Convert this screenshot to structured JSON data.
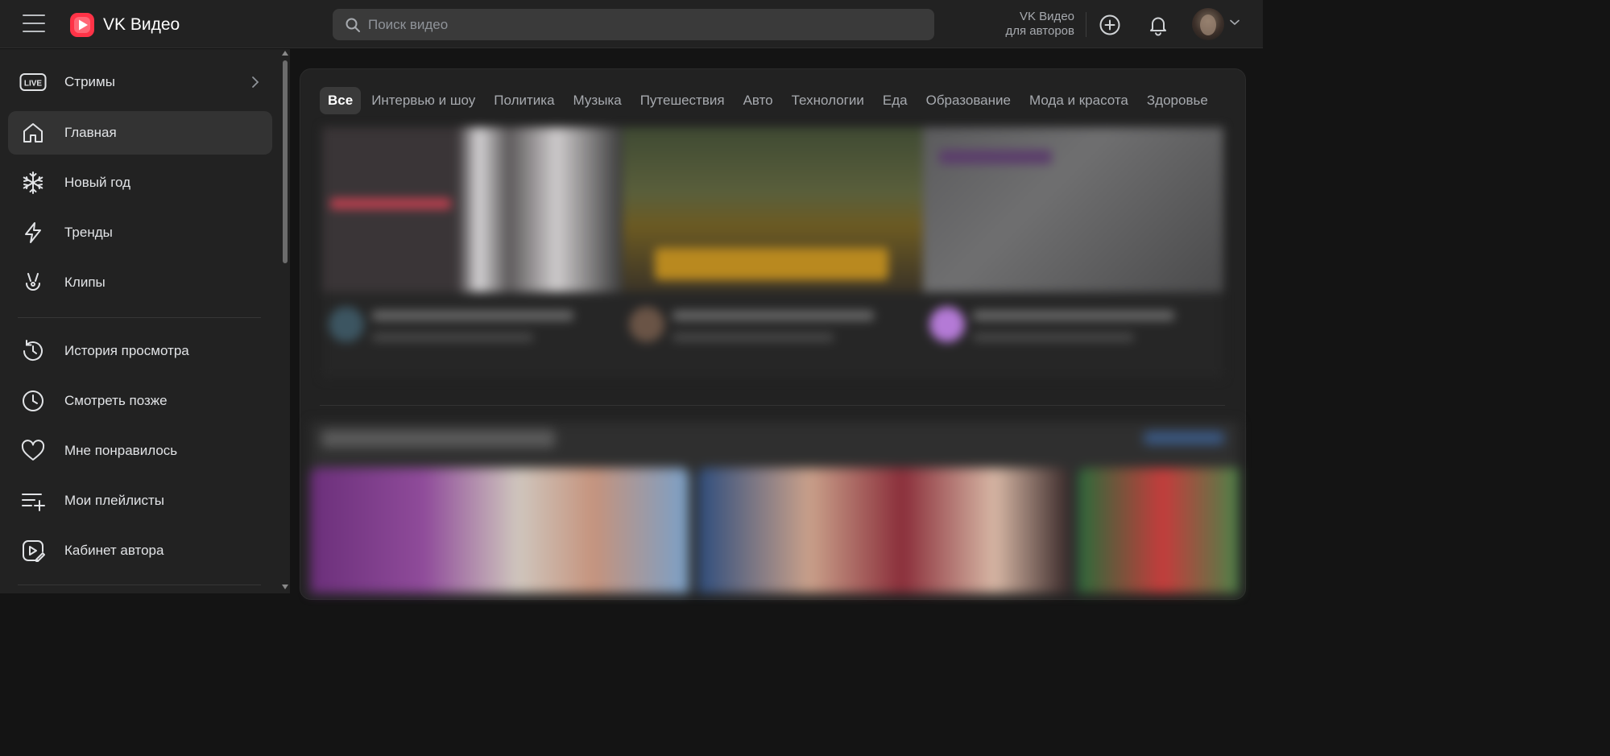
{
  "app": {
    "title": "VK Видео",
    "accent_color": "#ff3347"
  },
  "header": {
    "search_placeholder": "Поиск видео",
    "authors_line1": "VK Видео",
    "authors_line2": "для авторов",
    "icons": [
      "menu-icon",
      "search-icon",
      "add-icon",
      "bell-icon",
      "chevron-down-icon"
    ]
  },
  "sidebar": {
    "items": [
      {
        "label": "Стримы",
        "icon": "live-icon"
      },
      {
        "label": "Главная",
        "icon": "home-icon",
        "active": true
      },
      {
        "label": "Новый год",
        "icon": "snowflake-icon"
      },
      {
        "label": "Тренды",
        "icon": "lightning-icon"
      },
      {
        "label": "Клипы",
        "icon": "clips-icon"
      },
      {
        "label": "История просмотра",
        "icon": "history-icon"
      },
      {
        "label": "Смотреть позже",
        "icon": "clock-icon"
      },
      {
        "label": "Мне понравилось",
        "icon": "heart-icon"
      },
      {
        "label": "Мои плейлисты",
        "icon": "playlist-add-icon"
      },
      {
        "label": "Кабинет автора",
        "icon": "author-studio-icon"
      }
    ]
  },
  "categories": [
    {
      "label": "Все",
      "active": true
    },
    {
      "label": "Интервью и шоу"
    },
    {
      "label": "Политика"
    },
    {
      "label": "Музыка"
    },
    {
      "label": "Путешествия"
    },
    {
      "label": "Авто"
    },
    {
      "label": "Технологии"
    },
    {
      "label": "Еда"
    },
    {
      "label": "Образование"
    },
    {
      "label": "Мода и красота"
    },
    {
      "label": "Здоровье"
    }
  ]
}
